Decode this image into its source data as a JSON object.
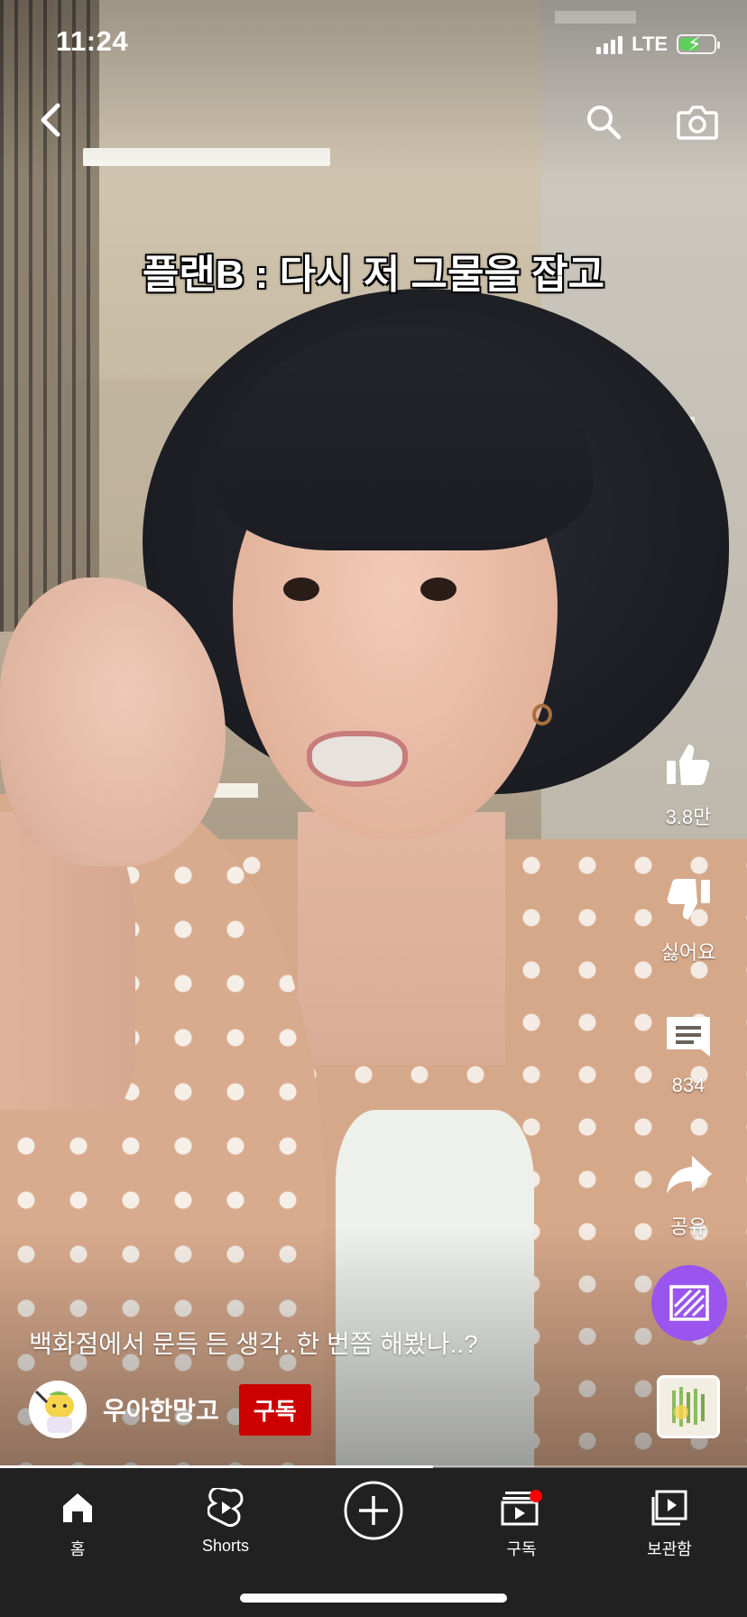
{
  "status_bar": {
    "time": "11:24",
    "network": "LTE",
    "battery_level": 0.55,
    "charging": true
  },
  "top_bar": {
    "back_icon": "chevron-left-icon",
    "search_icon": "search-icon",
    "camera_icon": "camera-icon"
  },
  "video": {
    "caption": "플랜B : 다시 저 그물을 잡고",
    "title": "백화점에서 문득 든 생각..한 번쯤 해봤나..?",
    "progress": 0.58
  },
  "actions": {
    "like_count": "3.8만",
    "dislike_label": "싫어요",
    "comment_count": "834",
    "share_label": "공유"
  },
  "channel": {
    "name": "우아한망고",
    "subscribe_label": "구독"
  },
  "nav": {
    "home_label": "홈",
    "shorts_label": "Shorts",
    "subscriptions_label": "구독",
    "library_label": "보관함"
  },
  "colors": {
    "subscribe": "#cc0000",
    "remix": "#9a55ef",
    "nav_background": "#212121",
    "notification_dot": "#ff0000",
    "battery_fill": "#5ed05a"
  }
}
